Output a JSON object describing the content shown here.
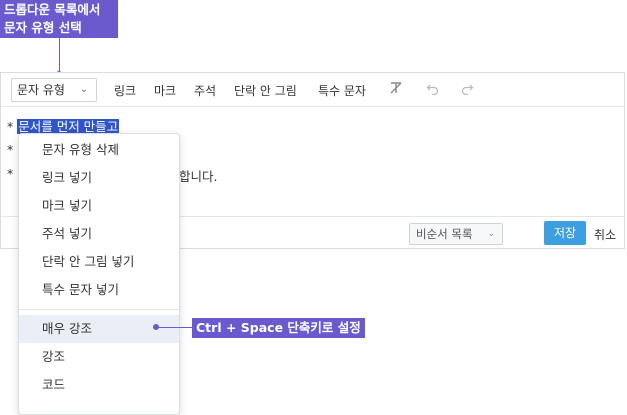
{
  "callouts": {
    "top_line1": "드롭다운 목록에서",
    "top_line2": "문자 유형 선택",
    "right": "Ctrl + Space 단축키로 설정"
  },
  "toolbar": {
    "type_select": "문자 유형",
    "link": "링크",
    "mark": "마크",
    "note": "주석",
    "inline_image": "단락 안 그림",
    "special_char": "특수 문자"
  },
  "content": {
    "bullet": "*",
    "line1_selected": "문서를 먼저 만들고",
    "line3_tail": "합니다."
  },
  "footer": {
    "list_select": "비순서 목록",
    "save": "저장",
    "cancel": "취소"
  },
  "menu": {
    "items": [
      "문자 유형 삭제",
      "링크 넣기",
      "마크 넣기",
      "주석 넣기",
      "단락 안 그림 넣기",
      "특수 문자 넣기",
      "매우 강조",
      "강조",
      "코드"
    ]
  },
  "colors": {
    "callout": "#6a5acd",
    "selection": "#2f55c9",
    "save_button": "#3b9fe0",
    "menu_active": "#ebeef7"
  },
  "icons": [
    "chevron-down-icon",
    "clear-format-icon",
    "undo-icon",
    "redo-icon"
  ]
}
